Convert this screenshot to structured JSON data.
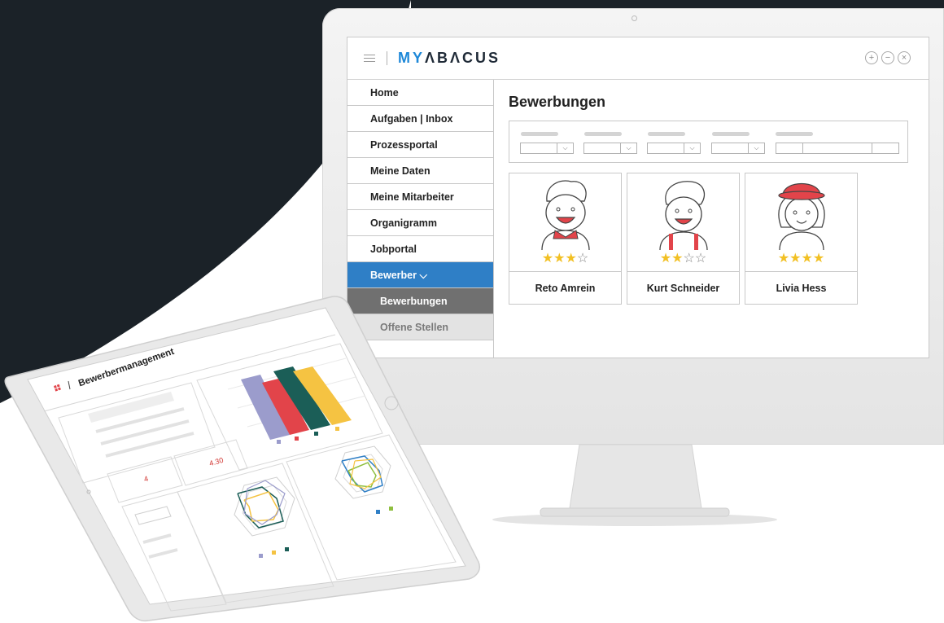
{
  "app": {
    "brand_my": "MY",
    "brand_rest": "ΛBΛCUS"
  },
  "window_controls": [
    "+",
    "−",
    "×"
  ],
  "sidebar": {
    "items": [
      {
        "label": "Home"
      },
      {
        "label": "Aufgaben | Inbox"
      },
      {
        "label": "Prozessportal"
      },
      {
        "label": "Meine Daten"
      },
      {
        "label": "Meine Mitarbeiter"
      },
      {
        "label": "Organigramm"
      },
      {
        "label": "Jobportal"
      },
      {
        "label": "Bewerber ⌵"
      },
      {
        "label": "Bewerbungen"
      },
      {
        "label": "Offene Stellen"
      }
    ]
  },
  "main": {
    "title": "Bewerbungen"
  },
  "candidates": [
    {
      "name": "Reto Amrein",
      "stars_on": "★★★",
      "stars_off": "☆",
      "rating": 3
    },
    {
      "name": "Kurt Schneider",
      "stars_on": "★★",
      "stars_off": "☆☆",
      "rating": 2
    },
    {
      "name": "Livia Hess",
      "stars_on": "★★★★",
      "stars_off": "",
      "rating": 4
    }
  ],
  "tablet": {
    "title": "Bewerbermanagement",
    "kpi_left": "4",
    "kpi_right": "4.30"
  },
  "colors": {
    "accent_blue": "#2f7fc6",
    "brand_blue": "#1e88d8",
    "star": "#f2c023",
    "bar_purple": "#9b9ccc",
    "bar_red": "#e2444a",
    "bar_green": "#1b5e57",
    "bar_yellow": "#f5c342",
    "dark_bg": "#1b2228"
  }
}
